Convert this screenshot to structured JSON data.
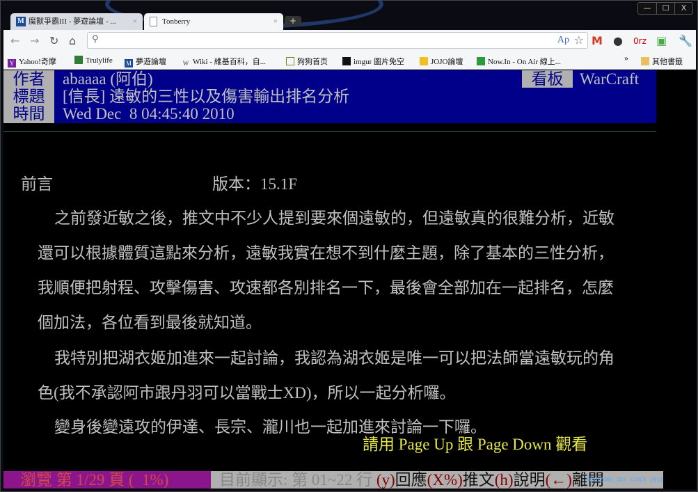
{
  "browser": {
    "tabs": [
      {
        "label": "魔獸爭霸III - 夢遊論壇 - ...",
        "icon": "m-site-icon"
      },
      {
        "label": "Tonberry",
        "icon": "page-icon"
      }
    ],
    "new_tab": "+",
    "window_controls": [
      "—",
      "☐",
      "X"
    ],
    "translate_icon_label": "Ap",
    "bookmarks": [
      {
        "label": "Yahoo!奇摩",
        "color": "#7b1fa2"
      },
      {
        "label": "Trulylife",
        "color": "#2e7d32"
      },
      {
        "label": "夢遊論壇",
        "color": "#1a4a9a"
      },
      {
        "label": "Wiki - 維基百科，自...",
        "color": "#333333"
      },
      {
        "label": "狗狗首页",
        "color": "#6b8e23"
      },
      {
        "label": "imgur 圖片免空",
        "color": "#111111"
      },
      {
        "label": "JOJO論壇",
        "color": "#f0c020"
      },
      {
        "label": "Now.In - On Air 線上...",
        "color": "#2e9a3e"
      }
    ],
    "overflow": "»",
    "other_bookmarks": "其他書籤"
  },
  "article": {
    "author_label": "作者",
    "author": "abaaaa (阿伯)",
    "title_label": "標題",
    "title": "[信長] 遠敏的三性以及傷害輸出排名分析",
    "time_label": "時間",
    "time": "Wed Dec  8 04:45:40 2010",
    "board_label": "看板",
    "board": "WarCraft",
    "intro": "前言",
    "version": "版本：15.1F",
    "lines": [
      "之前發近敏之後，推文中不少人提到要來個遠敏的，但遠敏真的很難分析，近敏",
      "還可以根據體質這點來分析，遠敏我實在想不到什麼主題，除了基本的三性分析，",
      "我順便把射程、攻擊傷害、攻速都各別排名一下，最後會全部加在一起排名，怎麼",
      "個加法，各位看到最後就知道。",
      "我特別把湖衣姬加進來一起討論，我認為湖衣姬是唯一可以把法師當遠敏玩的角",
      "色(我不承認阿市跟丹羽可以當戰士XD)，所以一起分析囉。",
      "變身後變遠攻的伊達、長宗、瀧川也一起加進來討論一下囉。"
    ],
    "hint": "請用 Page Up 跟 Page Down 觀看"
  },
  "status": {
    "browse": "瀏覽 第 1/29 頁 (  1%)",
    "showing": "目前顯示: 第 01~22 行 ",
    "k1": "(y)",
    "a1": "回應",
    "k2": "(X%)",
    "a2": "推文",
    "k3": "(h)",
    "a3": "說明",
    "k4": "(←)",
    "a4": "離開",
    "watermark": "MOYUZONE.2DS SINCE 2010"
  }
}
